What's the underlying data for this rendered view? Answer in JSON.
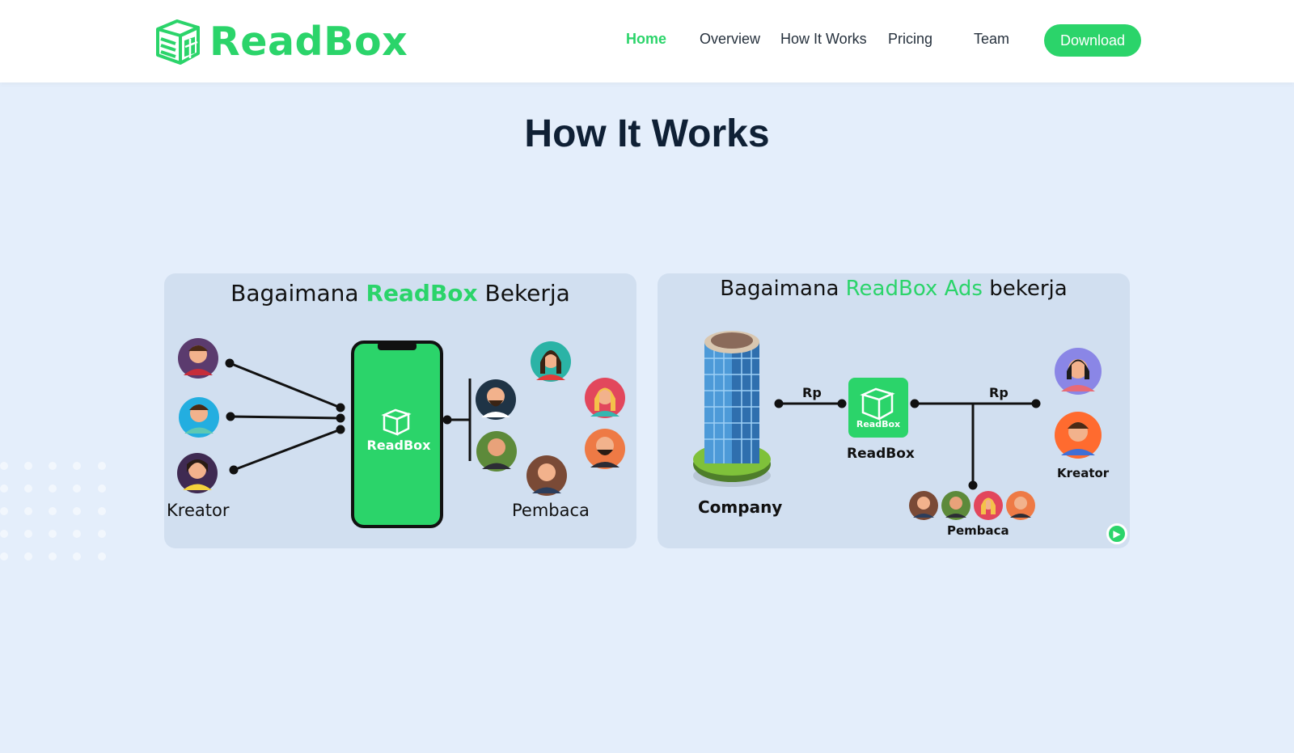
{
  "brand": {
    "name": "ReadBox",
    "color": "#2bd46a",
    "logo_icon": "box-book-icon"
  },
  "nav": {
    "items": [
      {
        "label": "Home",
        "active": true
      },
      {
        "label": "Overview",
        "active": false
      },
      {
        "label": "How It Works",
        "active": false
      },
      {
        "label": "Pricing",
        "active": false
      },
      {
        "label": "Team",
        "active": false
      }
    ],
    "download_label": "Download"
  },
  "section": {
    "title": "How It Works"
  },
  "panel_left": {
    "title_prefix": "Bagaimana",
    "title_brand": "ReadBox",
    "title_suffix": "Bekerja",
    "app_label": "ReadBox",
    "creators_label": "Kreator",
    "readers_label": "Pembaca"
  },
  "panel_right": {
    "title_prefix": "Bagaimana",
    "title_brand": "ReadBox Ads",
    "title_suffix": "bekerja",
    "company_label": "Company",
    "hub_label": "ReadBox",
    "hub_icon_label": "ReadBox",
    "payment_left": "Rp",
    "payment_right": "Rp",
    "creator_label": "Kreator",
    "readers_label": "Pembaca"
  },
  "colors": {
    "background": "#e4eefb",
    "panel": "#d1dff0",
    "heading": "#0f2035"
  }
}
